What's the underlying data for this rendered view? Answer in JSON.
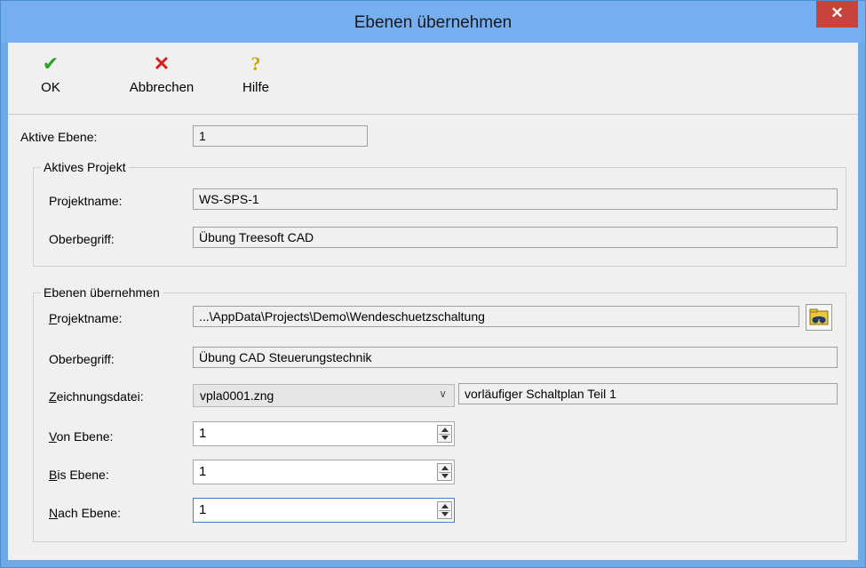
{
  "window": {
    "title": "Ebenen übernehmen",
    "close_glyph": "✕"
  },
  "toolbar": {
    "ok": {
      "label": "OK",
      "icon": "check-icon",
      "glyph": "✔",
      "color": "#2ea02e"
    },
    "cancel": {
      "label": "Abbrechen",
      "icon": "x-icon",
      "glyph": "✕",
      "color": "#d62020"
    },
    "help": {
      "label": "Hilfe",
      "icon": "question-icon",
      "glyph": "?",
      "color": "#c9a800"
    }
  },
  "active_layer": {
    "label": "Aktive Ebene:",
    "value": "1"
  },
  "active_project": {
    "title": "Aktives Projekt",
    "projektname_label": "Projektname:",
    "projektname_value": "WS-SPS-1",
    "oberbegriff_label": "Oberbegriff:",
    "oberbegriff_value": "Übung Treesoft CAD"
  },
  "import": {
    "title": "Ebenen übernehmen",
    "projektname_label_key": "P",
    "projektname_label_rest": "rojektname:",
    "projektname_value": "...\\AppData\\Projects\\Demo\\Wendeschuetzschaltung",
    "browse_icon": "binoculars-folder-icon",
    "oberbegriff_label": "Oberbegriff:",
    "oberbegriff_value": "Übung CAD Steuerungstechnik",
    "zeichnung_label_key": "Z",
    "zeichnung_label_rest": "eichnungsdatei:",
    "zeichnung_value": "vpla0001.zng",
    "zeichnung_desc": "vorläufiger Schaltplan Teil 1",
    "von_label_key": "V",
    "von_label_rest": "on Ebene:",
    "von_value": "1",
    "bis_label_key": "B",
    "bis_label_rest": "is Ebene:",
    "bis_value": "1",
    "nach_label_key": "N",
    "nach_label_rest": "ach Ebene:",
    "nach_value": "1"
  }
}
